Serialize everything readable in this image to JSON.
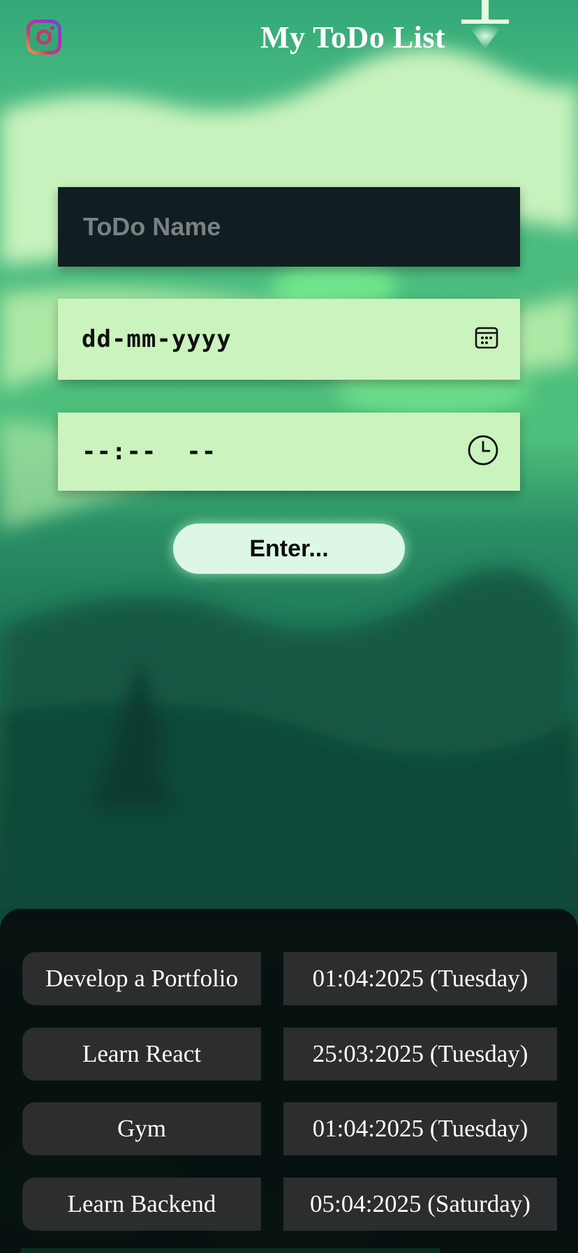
{
  "header": {
    "title": "My ToDo List",
    "social_icon": "instagram-icon"
  },
  "form": {
    "name_placeholder": "ToDo Name",
    "date_placeholder": "dd-mm-yyyy",
    "date_icon": "calendar-icon",
    "time_placeholder": "--:--  --",
    "time_icon": "clock-icon",
    "enter_label": "Enter..."
  },
  "todos": [
    {
      "name": "Develop a Portfolio",
      "date": "01:04:2025 (Tuesday)"
    },
    {
      "name": "Learn React",
      "date": "25:03:2025 (Tuesday)"
    },
    {
      "name": "Gym",
      "date": "01:04:2025 (Tuesday)"
    },
    {
      "name": "Learn Backend",
      "date": "05:04:2025 (Saturday)"
    }
  ],
  "colors": {
    "sky_green": "#33a877",
    "light_green_input": "#cbf3be",
    "dark_input": "#101e21",
    "button": "#dcf7e4",
    "panel": "#060e0e",
    "cell": "#2b2d2e"
  }
}
